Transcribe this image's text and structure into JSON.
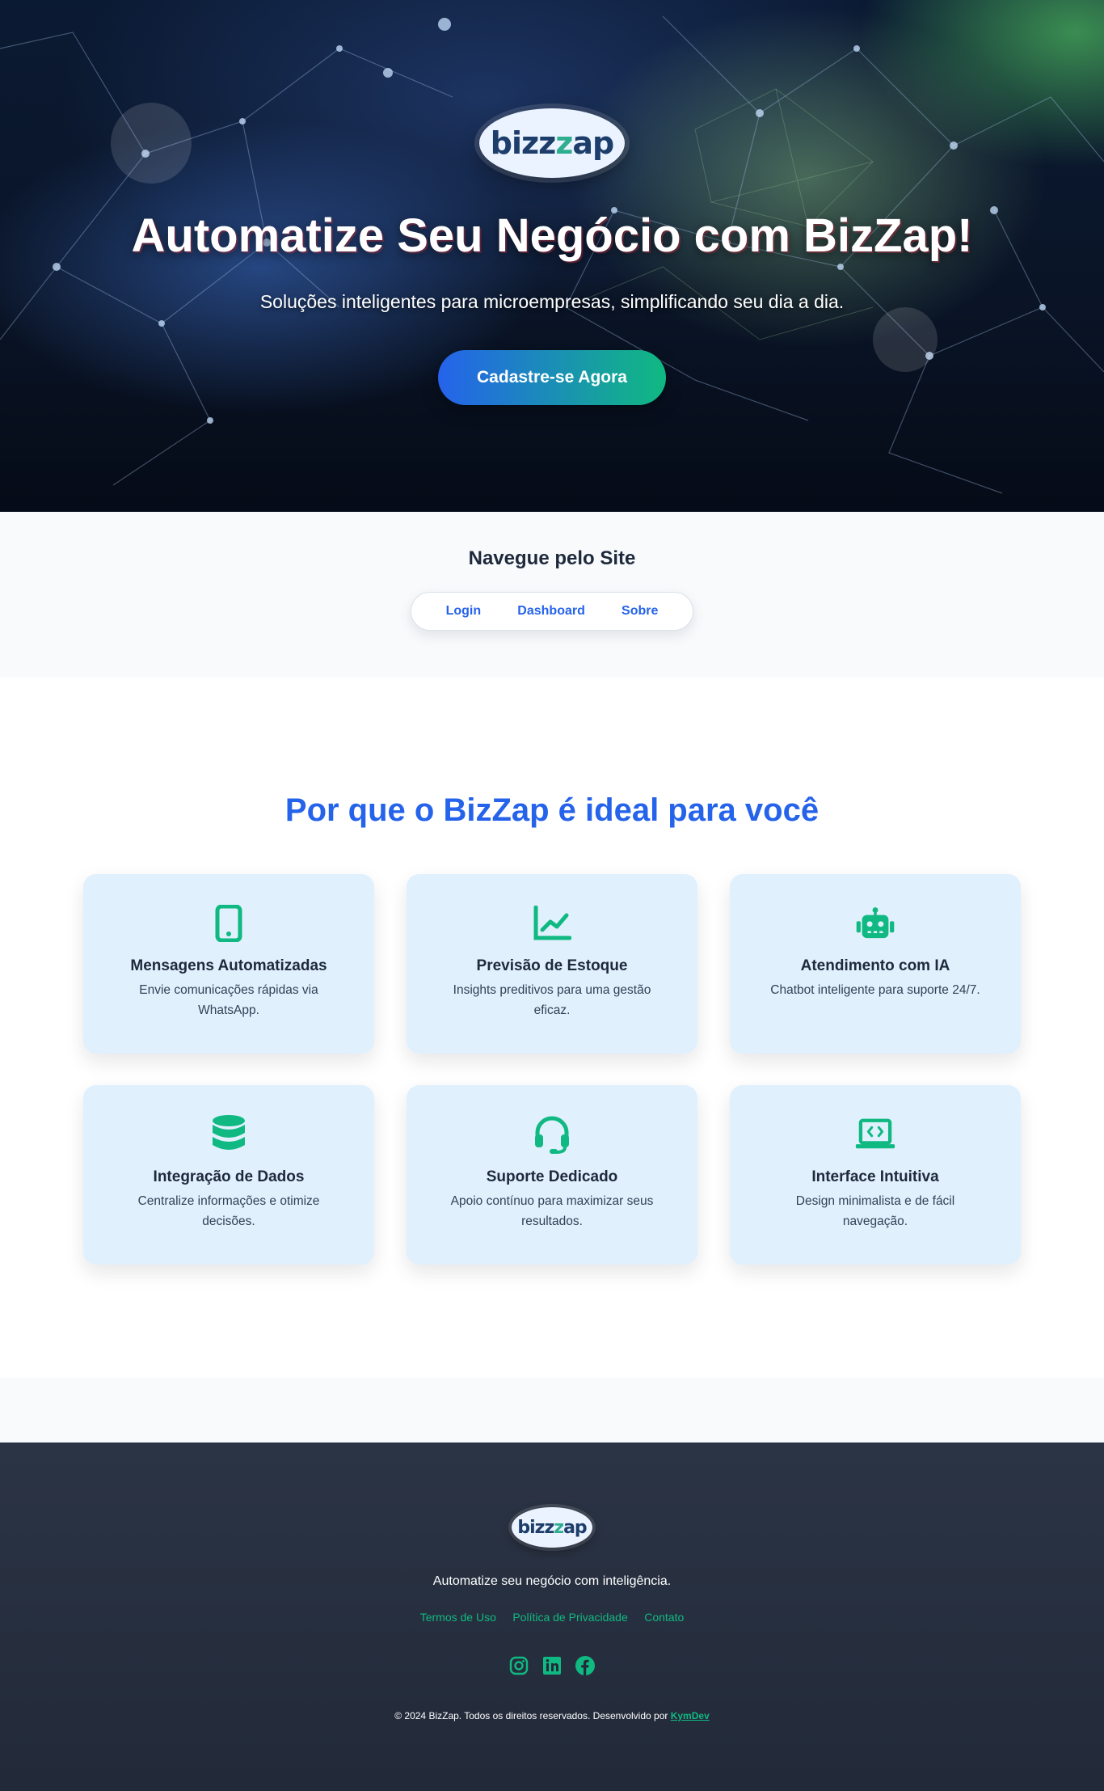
{
  "hero": {
    "logo_text_a": "bizz",
    "logo_text_b": "ap",
    "title": "Automatize Seu Negócio com BizZap!",
    "subtitle": "Soluções inteligentes para microempresas, simplificando seu dia a dia.",
    "cta_label": "Cadastre-se Agora"
  },
  "nav": {
    "title": "Navegue pelo Site",
    "links": [
      {
        "label": "Login"
      },
      {
        "label": "Dashboard"
      },
      {
        "label": "Sobre"
      }
    ]
  },
  "features": {
    "title": "Por que o BizZap é ideal para você",
    "cards": [
      {
        "icon": "mobile-phone-icon",
        "title": "Mensagens Automatizadas",
        "description": "Envie comunicações rápidas via WhatsApp."
      },
      {
        "icon": "chart-line-icon",
        "title": "Previsão de Estoque",
        "description": "Insights preditivos para uma gestão eficaz."
      },
      {
        "icon": "robot-icon",
        "title": "Atendimento com IA",
        "description": "Chatbot inteligente para suporte 24/7."
      },
      {
        "icon": "database-icon",
        "title": "Integração de Dados",
        "description": "Centralize informações e otimize decisões."
      },
      {
        "icon": "headset-icon",
        "title": "Suporte Dedicado",
        "description": "Apoio contínuo para maximizar seus resultados."
      },
      {
        "icon": "laptop-code-icon",
        "title": "Interface Intuitiva",
        "description": "Design minimalista e de fácil navegação."
      }
    ]
  },
  "footer": {
    "tagline": "Automatize seu negócio com inteligência.",
    "links": [
      {
        "label": "Termos de Uso"
      },
      {
        "label": "Política de Privacidade"
      },
      {
        "label": "Contato"
      }
    ],
    "social": [
      "instagram-icon",
      "linkedin-icon",
      "facebook-icon"
    ],
    "copyright": "© 2024 BizZap. Todos os direitos reservados. Desenvolvido por",
    "developer": "KymDev"
  },
  "colors": {
    "primary_blue": "#2563eb",
    "accent_green": "#10b981",
    "card_bg": "#e0f0fd",
    "footer_bg": "#2b3445"
  }
}
